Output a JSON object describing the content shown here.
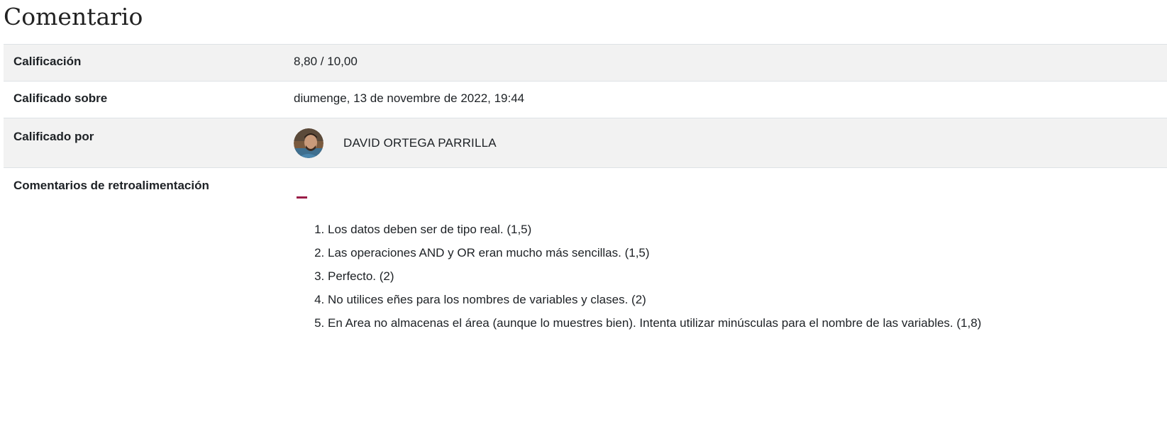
{
  "section": {
    "title": "Comentario"
  },
  "grade": {
    "label": "Calificación",
    "value": "8,80 / 10,00"
  },
  "graded_on": {
    "label": "Calificado sobre",
    "value": "diumenge, 13 de novembre de 2022, 19:44"
  },
  "graded_by": {
    "label": "Calificado por",
    "name": "DAVID ORTEGA PARRILLA",
    "avatar_icon": "user-avatar-photo"
  },
  "feedback": {
    "label": "Comentarios de retroalimentación",
    "items": [
      "Los datos deben ser de tipo real. (1,5)",
      "Las operaciones AND y OR eran mucho más sencillas. (1,5)",
      "Perfecto. (2)",
      "No utilices eñes para los nombres de variables y clases. (2)",
      "En Area no almacenas el área (aunque lo muestres bien). Intenta utilizar minúsculas para el nombre de las variables. (1,8)"
    ]
  },
  "colors": {
    "row_shade": "#f2f2f2",
    "accent_dash": "#9a1c47",
    "text": "#1d2125"
  }
}
